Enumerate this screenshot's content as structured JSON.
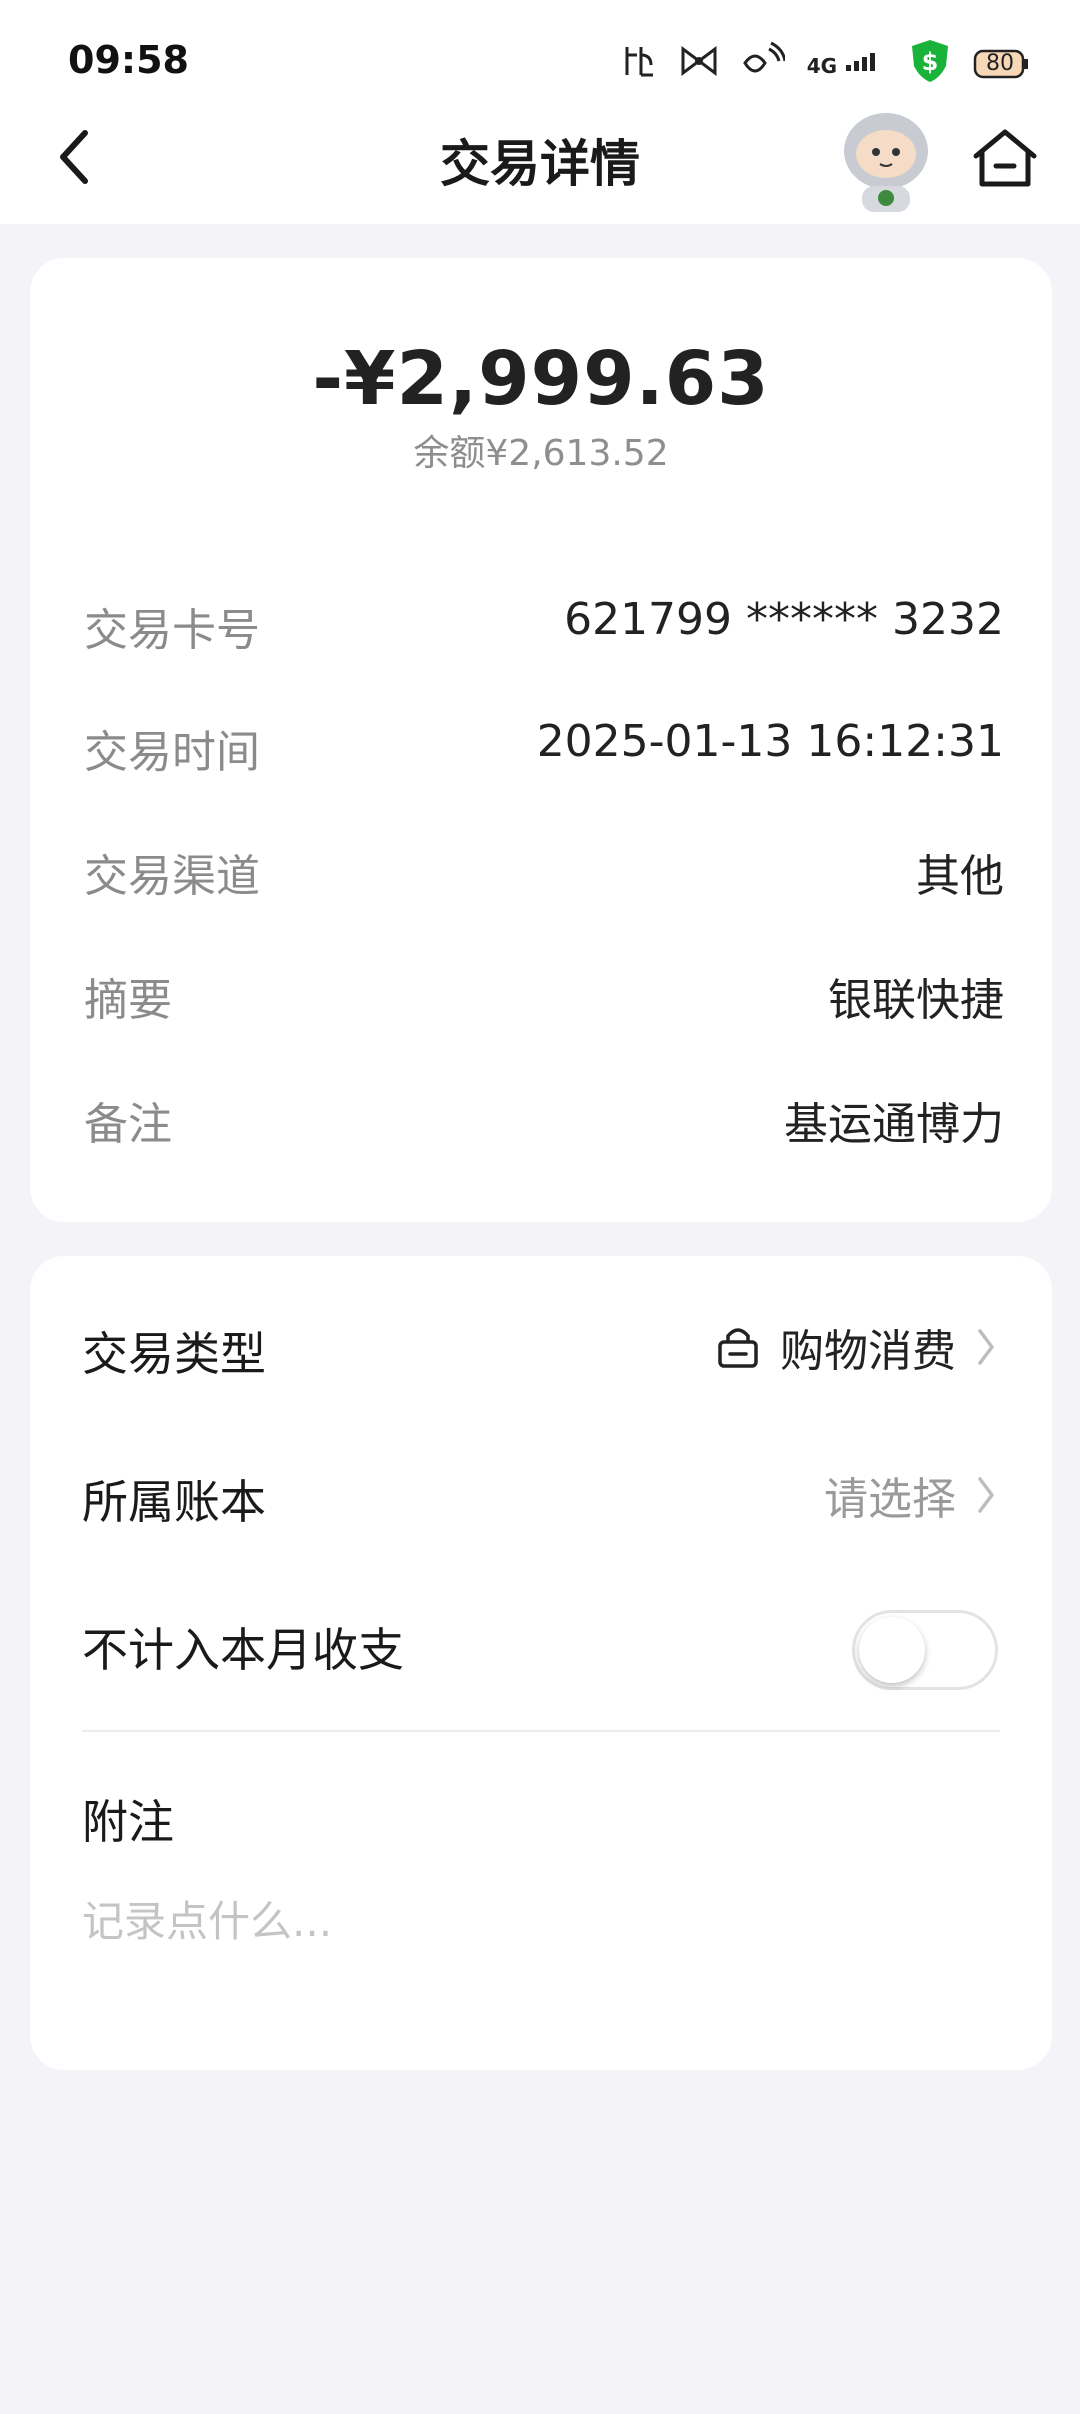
{
  "status_bar": {
    "time": "09:58",
    "network": "4G",
    "battery": "80"
  },
  "header": {
    "title": "交易详情"
  },
  "transaction": {
    "amount": "-¥2,999.63",
    "balance": "余额¥2,613.52",
    "details": [
      {
        "label": "交易卡号",
        "value": "621799 ****** 3232"
      },
      {
        "label": "交易时间",
        "value": "2025-01-13 16:12:31"
      },
      {
        "label": "交易渠道",
        "value": "其他"
      },
      {
        "label": "摘要",
        "value": "银联快捷"
      },
      {
        "label": "备注",
        "value": "基运通博力"
      }
    ]
  },
  "options": {
    "type_label": "交易类型",
    "type_value": "购物消费",
    "book_label": "所属账本",
    "book_value": "请选择",
    "exclude_label": "不计入本月收支",
    "exclude_enabled": false,
    "note_label": "附注",
    "note_placeholder": "记录点什么..."
  },
  "colors": {
    "background": "#f3f3f8",
    "card": "#ffffff",
    "status_shield": "#19b33a"
  }
}
